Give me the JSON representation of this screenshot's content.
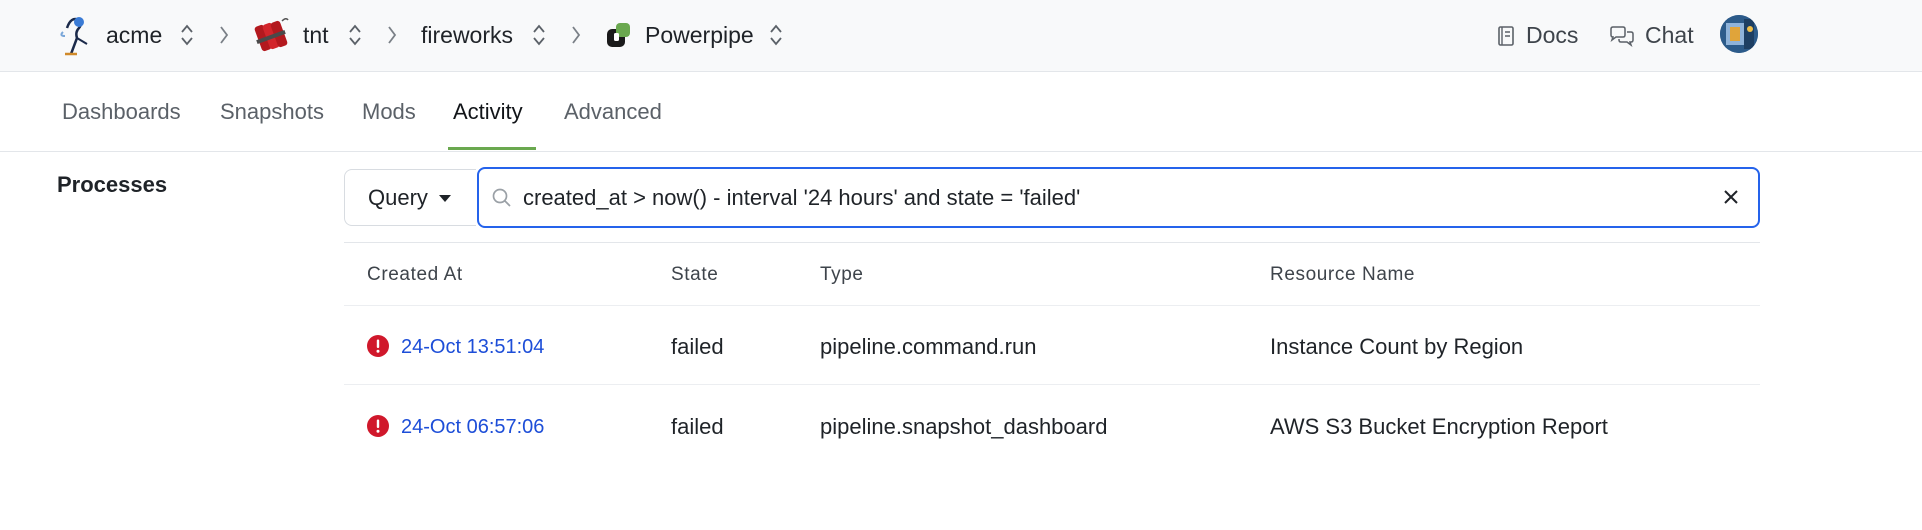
{
  "breadcrumb": {
    "org": "acme",
    "workspace": "tnt",
    "mod": "fireworks",
    "product": "Powerpipe"
  },
  "top_links": {
    "docs": "Docs",
    "chat": "Chat"
  },
  "tabs": [
    {
      "label": "Dashboards"
    },
    {
      "label": "Snapshots"
    },
    {
      "label": "Mods"
    },
    {
      "label": "Activity",
      "active": true
    },
    {
      "label": "Advanced"
    }
  ],
  "section_title": "Processes",
  "filter": {
    "mode_label": "Query",
    "query_value": "created_at > now() - interval '24 hours' and state = 'failed'"
  },
  "table": {
    "columns": [
      "Created At",
      "State",
      "Type",
      "Resource Name"
    ],
    "rows": [
      {
        "created_at": "24-Oct 13:51:04",
        "state": "failed",
        "type": "pipeline.command.run",
        "resource_name": "Instance Count by Region"
      },
      {
        "created_at": "24-Oct 06:57:06",
        "state": "failed",
        "type": "pipeline.snapshot_dashboard",
        "resource_name": "AWS S3 Bucket Encryption Report"
      }
    ]
  },
  "colors": {
    "accent_blue": "#2563eb",
    "tab_underline": "#6aa84f",
    "error_red": "#d0182b",
    "link_blue": "#1d4ed8"
  }
}
